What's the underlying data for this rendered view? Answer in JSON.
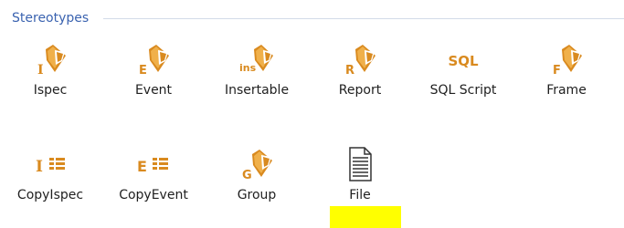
{
  "group": {
    "title": "Stereotypes"
  },
  "items": [
    {
      "label": "Ispec",
      "icon": "ispec-stereotype-icon",
      "letter": "I"
    },
    {
      "label": "Event",
      "icon": "event-stereotype-icon",
      "letter": "E"
    },
    {
      "label": "Insertable",
      "icon": "insertable-stereotype-icon",
      "letter": "ins"
    },
    {
      "label": "Report",
      "icon": "report-stereotype-icon",
      "letter": "R"
    },
    {
      "label": "SQL Script",
      "icon": "sql-script-icon",
      "letter": "SQL"
    },
    {
      "label": "Frame",
      "icon": "frame-stereotype-icon",
      "letter": "F"
    },
    {
      "label": "CopyIspec",
      "icon": "copyispec-icon",
      "letter": "I"
    },
    {
      "label": "CopyEvent",
      "icon": "copyevent-icon",
      "letter": "E"
    },
    {
      "label": "Group",
      "icon": "group-stereotype-icon",
      "letter": "G"
    },
    {
      "label": "File",
      "icon": "file-icon"
    }
  ],
  "colors": {
    "icon_orange": "#d98a1f",
    "header_blue": "#3b63b0",
    "highlight_yellow": "#ffff00"
  }
}
